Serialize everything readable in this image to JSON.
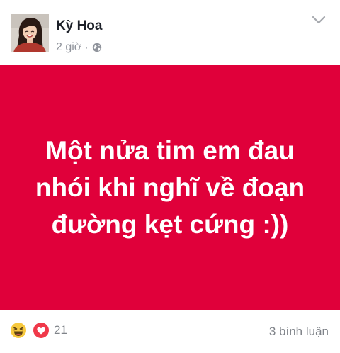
{
  "post": {
    "author": {
      "name": "Kỳ Hoa",
      "avatar_icon": "profile-photo"
    },
    "timestamp": "2 giờ",
    "separator": "·",
    "privacy_icon": "globe-icon",
    "menu_icon": "chevron-down-icon",
    "status": {
      "text": "Một nửa tim em đau nhói khi nghĩ về đoạn đường kẹt cứng :))",
      "background_color": "#e0003a",
      "text_color": "#ffffff"
    },
    "reactions": {
      "icons": [
        "haha-icon",
        "love-icon"
      ],
      "count": "21"
    },
    "comments": {
      "label": "3 bình luận"
    }
  }
}
